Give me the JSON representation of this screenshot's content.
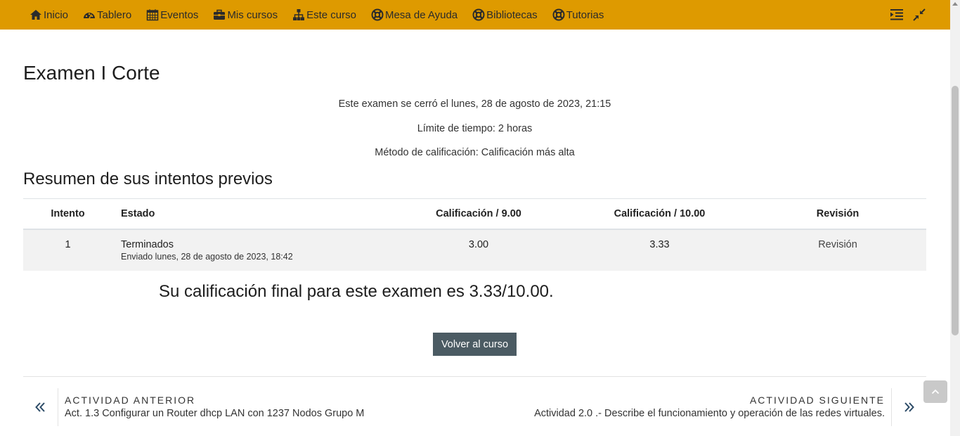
{
  "nav": {
    "items": [
      {
        "label": "Inicio",
        "icon": "home-icon"
      },
      {
        "label": "Tablero",
        "icon": "dashboard-icon"
      },
      {
        "label": "Eventos",
        "icon": "calendar-icon"
      },
      {
        "label": "Mis cursos",
        "icon": "briefcase-icon"
      },
      {
        "label": "Este curso",
        "icon": "sitemap-icon"
      },
      {
        "label": "Mesa de Ayuda",
        "icon": "lifebuoy-icon"
      },
      {
        "label": "Bibliotecas",
        "icon": "lifebuoy-icon"
      },
      {
        "label": "Tutorias",
        "icon": "lifebuoy-icon"
      }
    ],
    "bg_color": "#de9a00"
  },
  "page": {
    "title": "Examen I Corte",
    "closed_info": "Este examen se cerró el lunes, 28 de agosto de 2023, 21:15",
    "time_limit": "Límite de tiempo: 2 horas",
    "grading_method": "Método de calificación: Calificación más alta"
  },
  "summary": {
    "heading": "Resumen de sus intentos previos",
    "columns": [
      "Intento",
      "Estado",
      "Calificación / 9.00",
      "Calificación / 10.00",
      "Revisión"
    ],
    "rows": [
      {
        "attempt": "1",
        "state": "Terminados",
        "submitted": "Enviado lunes, 28 de agosto de 2023, 18:42",
        "grade9": "3.00",
        "grade10": "3.33",
        "review": "Revisión"
      }
    ]
  },
  "final_grade": "Su calificación final para este examen es 3.33/10.00.",
  "back_button": "Volver al curso",
  "activity_nav": {
    "prev_kicker": "ACTIVIDAD ANTERIOR",
    "prev_name": "Act. 1.3 Configurar un Router dhcp LAN con 1237 Nodos Grupo M",
    "next_kicker": "ACTIVIDAD SIGUIENTE",
    "next_name": "Actividad 2.0 .- Describe el funcionamiento y operación de las redes virtuales."
  },
  "colors": {
    "button_bg": "#4b5b63",
    "row_bg": "#f2f2f2"
  }
}
